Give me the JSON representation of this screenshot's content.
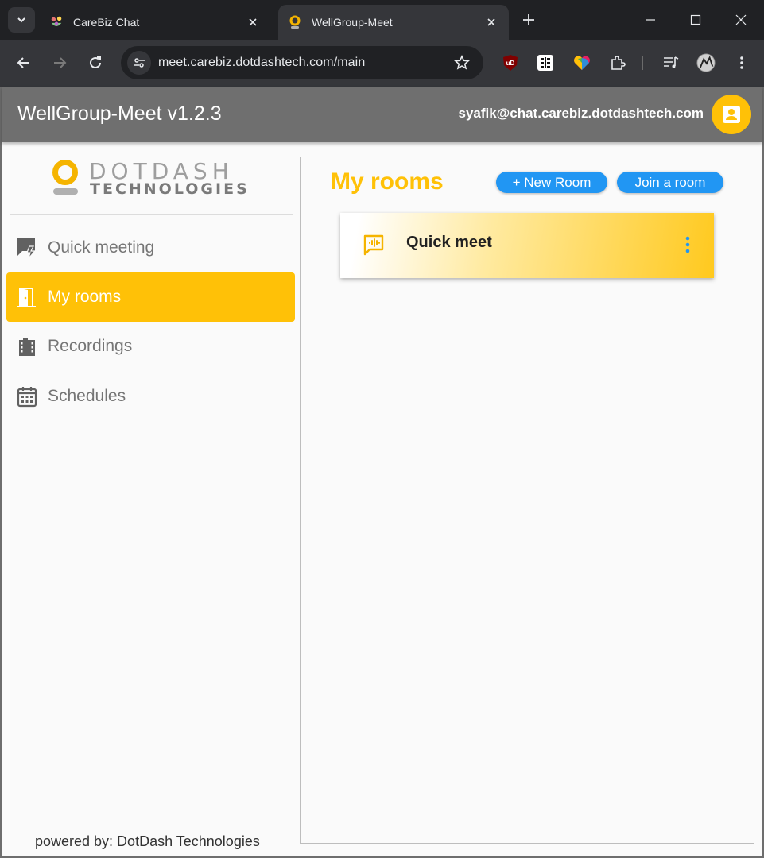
{
  "browser": {
    "tabs": [
      {
        "title": "CareBiz Chat",
        "favicon": "carebiz-favicon"
      },
      {
        "title": "WellGroup-Meet",
        "favicon": "dotdash-favicon"
      }
    ],
    "url": "meet.carebiz.dotdashtech.com/main"
  },
  "header": {
    "title": "WellGroup-Meet v1.2.3",
    "user_email": "syafik@chat.carebiz.dotdashtech.com",
    "avatar_icon": "contact-card-icon"
  },
  "logo": {
    "line1": "DOTDASH",
    "line2": "TECHNOLOGIES"
  },
  "sidebar": {
    "items": [
      {
        "label": "Quick meeting",
        "icon": "quick-meeting-icon",
        "active": false
      },
      {
        "label": "My rooms",
        "icon": "door-icon",
        "active": true
      },
      {
        "label": "Recordings",
        "icon": "film-icon",
        "active": false
      },
      {
        "label": "Schedules",
        "icon": "calendar-icon",
        "active": false
      }
    ],
    "footer": "powered by: DotDash Technologies"
  },
  "main": {
    "title": "My rooms",
    "new_room_label": "+ New Room",
    "join_room_label": "Join a room",
    "rooms": [
      {
        "name": "Quick meet",
        "icon": "voice-chat-icon"
      }
    ]
  },
  "colors": {
    "accent": "#ffc107",
    "button_blue": "#2196f3",
    "app_bar": "#6f6f6f"
  }
}
